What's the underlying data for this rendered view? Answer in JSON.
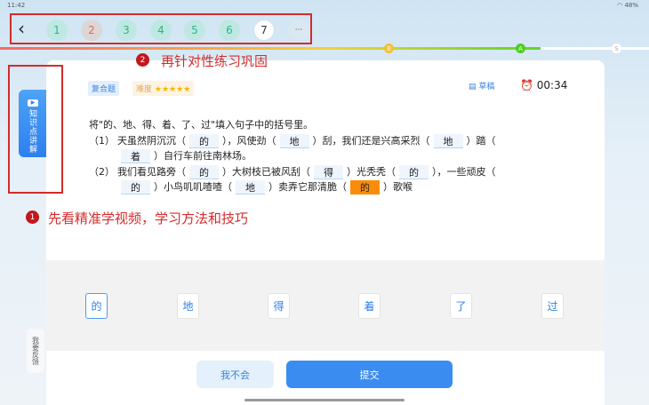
{
  "status": {
    "time": "11:42",
    "battery": "48%"
  },
  "nav": {
    "back": "‹",
    "questions": [
      "1",
      "2",
      "3",
      "4",
      "5",
      "6",
      "7"
    ],
    "more": "···"
  },
  "progress": {
    "marks": [
      "B",
      "A",
      "S"
    ],
    "percent": 83
  },
  "tips": [
    {
      "num": "1",
      "text": "先看精准学视频，学习方法和技巧"
    },
    {
      "num": "2",
      "text": "再针对性练习巩固"
    }
  ],
  "header": {
    "type": "复合题",
    "difficulty_label": "难度",
    "stars": "★★★★★",
    "draft": "草稿",
    "timer": "00:34"
  },
  "side": {
    "knowledge": "知识点讲解",
    "feedback": "我要反馈"
  },
  "question": {
    "prompt": "将\"的、地、得、着、了、过\"填入句子中的括号里。",
    "n1": "（1）",
    "n2": "（2）",
    "s1": [
      "天虽然阴沉沉（",
      "），风使劲（",
      "）刮，我们还是兴高采烈（",
      "）踏（"
    ],
    "s1b": [
      "）自行车前往南林场。"
    ],
    "s2": [
      "我们看见路旁（",
      "）大树枝已被风刮（",
      "）光秃秃（",
      "），一些顽皮（"
    ],
    "s2b": [
      "）小鸟叽叽喳喳（",
      "）卖弄它那清脆（",
      "）歌喉"
    ],
    "answers": [
      "的",
      "地",
      "地",
      "着",
      "的",
      "得",
      "的",
      "的",
      "地",
      "的"
    ]
  },
  "options": [
    "的",
    "地",
    "得",
    "着",
    "了",
    "过"
  ],
  "buttons": {
    "skip": "我不会",
    "submit": "提交"
  }
}
